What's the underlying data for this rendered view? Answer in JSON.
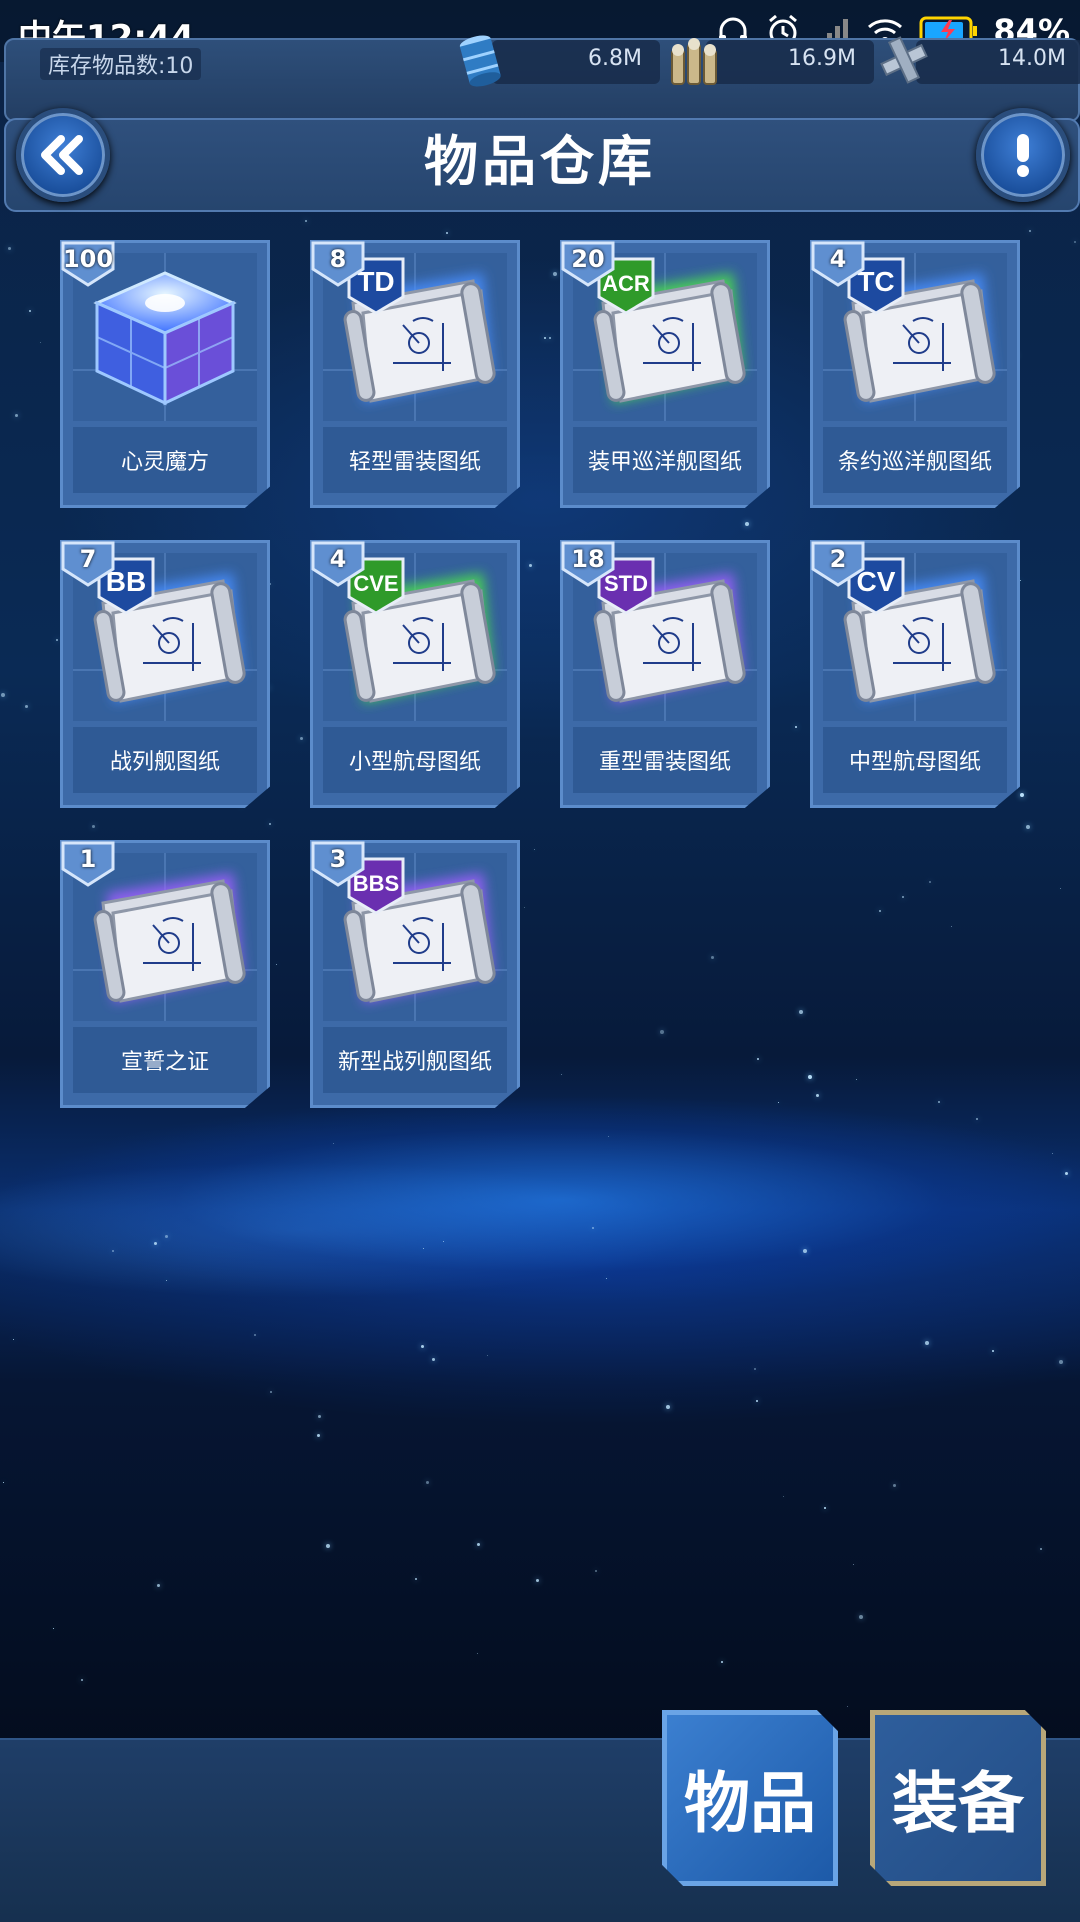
{
  "status_bar": {
    "time": "中午12:44",
    "battery": "84%"
  },
  "resources": {
    "inventory_label": "库存物品数:10",
    "oil": "6.8M",
    "ammo": "16.9M",
    "steel": "14.0M"
  },
  "header": {
    "title": "物品仓库"
  },
  "items": [
    {
      "name": "心灵魔方",
      "count": "100",
      "type": "cube"
    },
    {
      "name": "轻型雷装图纸",
      "count": "8",
      "type": "blueprint",
      "tag": "TD",
      "tag_color": "#1d4aa0",
      "glow": "#4a8fff"
    },
    {
      "name": "装甲巡洋舰图纸",
      "count": "20",
      "type": "blueprint",
      "tag": "ACR",
      "tag_color": "#2f9a2a",
      "glow": "#4ee04e"
    },
    {
      "name": "条约巡洋舰图纸",
      "count": "4",
      "type": "blueprint",
      "tag": "TC",
      "tag_color": "#1d4aa0",
      "glow": "#4a8fff"
    },
    {
      "name": "战列舰图纸",
      "count": "7",
      "type": "blueprint",
      "tag": "BB",
      "tag_color": "#1d4aa0",
      "glow": "#4a8fff"
    },
    {
      "name": "小型航母图纸",
      "count": "4",
      "type": "blueprint",
      "tag": "CVE",
      "tag_color": "#2f9a2a",
      "glow": "#4ee04e"
    },
    {
      "name": "重型雷装图纸",
      "count": "18",
      "type": "blueprint",
      "tag": "STD",
      "tag_color": "#6a2fb0",
      "glow": "#a060ff"
    },
    {
      "name": "中型航母图纸",
      "count": "2",
      "type": "blueprint",
      "tag": "CV",
      "tag_color": "#1d4aa0",
      "glow": "#4a8fff"
    },
    {
      "name": "宣誓之证",
      "count": "1",
      "type": "blueprint",
      "tag": "",
      "tag_color": "#6a2fb0",
      "glow": "#a060ff"
    },
    {
      "name": "新型战列舰图纸",
      "count": "3",
      "type": "blueprint",
      "tag": "BBS",
      "tag_color": "#6a2fb0",
      "glow": "#a060ff"
    }
  ],
  "tabs": {
    "items": "物品",
    "equipment": "装备"
  }
}
